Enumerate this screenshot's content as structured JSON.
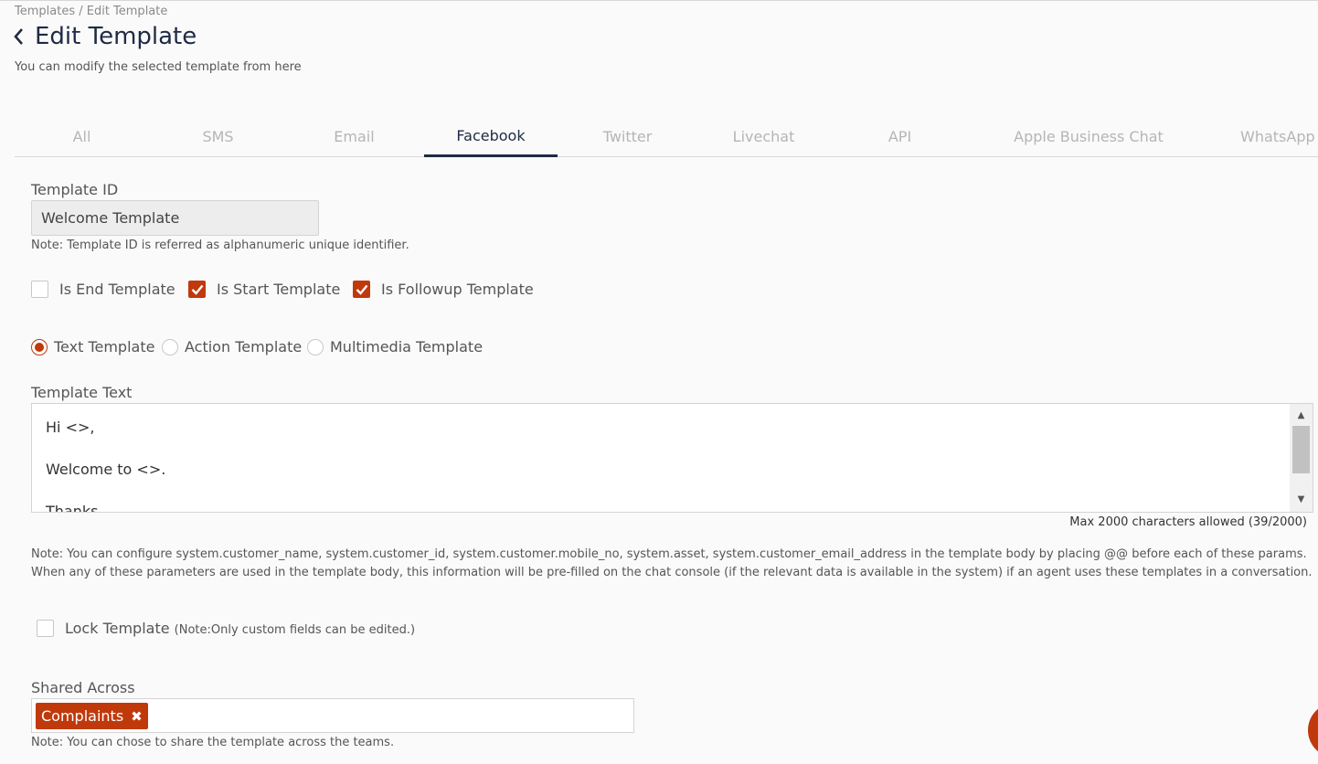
{
  "breadcrumb": "Templates / Edit Template",
  "page_title": "Edit Template",
  "subtitle": "You can modify the selected template from here",
  "tabs": [
    {
      "label": "All",
      "active": false
    },
    {
      "label": "SMS",
      "active": false
    },
    {
      "label": "Email",
      "active": false
    },
    {
      "label": "Facebook",
      "active": true
    },
    {
      "label": "Twitter",
      "active": false
    },
    {
      "label": "Livechat",
      "active": false
    },
    {
      "label": "API",
      "active": false
    },
    {
      "label": "Apple Business Chat",
      "active": false
    },
    {
      "label": "WhatsApp",
      "active": false
    }
  ],
  "template_id": {
    "label": "Template ID",
    "value": "Welcome Template",
    "note": "Note: Template ID is referred as alphanumeric unique identifier."
  },
  "checkboxes": [
    {
      "label": "Is End Template",
      "checked": false
    },
    {
      "label": "Is Start Template",
      "checked": true
    },
    {
      "label": "Is Followup Template",
      "checked": true
    }
  ],
  "template_types": [
    {
      "label": "Text Template",
      "selected": true
    },
    {
      "label": "Action Template",
      "selected": false
    },
    {
      "label": "Multimedia Template",
      "selected": false
    }
  ],
  "template_text": {
    "label": "Template Text",
    "lines": [
      "Hi <>,",
      "",
      "Welcome to <>.",
      "",
      "Thanks"
    ],
    "char_count": "Max 2000 characters allowed (39/2000)"
  },
  "params_note": {
    "line1": "Note: You can configure system.customer_name, system.customer_id, system.customer.mobile_no, system.asset, system.customer_email_address in the template body by placing @@ before each of these params.",
    "line2": "When any of these parameters are used in the template body, this information will be pre-filled on the chat console (if the relevant data is available in the system) if an agent uses these templates in a conversation."
  },
  "lock_template": {
    "label": "Lock Template",
    "note": "(Note:Only custom fields can be edited.)",
    "checked": false
  },
  "shared_across": {
    "label": "Shared Across",
    "tags": [
      "Complaints"
    ],
    "note": "Note: You can chose to share the template across the teams."
  },
  "colors": {
    "accent": "#c0390b",
    "title": "#1f2a44"
  }
}
